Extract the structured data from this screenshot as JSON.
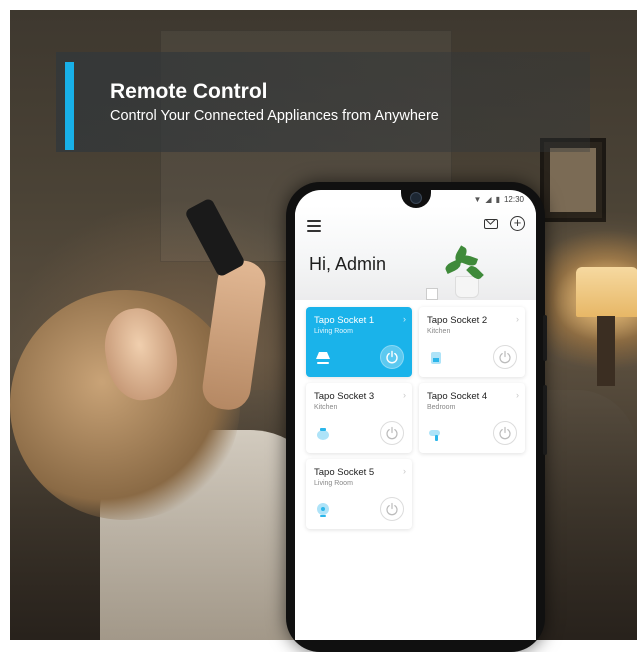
{
  "banner": {
    "title": "Remote Control",
    "subtitle": "Control Your Connected Appliances from Anywhere"
  },
  "status_bar": {
    "time": "12:30",
    "icons": [
      "wifi-icon",
      "signal-icon",
      "battery-icon"
    ]
  },
  "app": {
    "greeting": "Hi, Admin",
    "header_icons": [
      "menu-icon",
      "mail-icon",
      "add-icon"
    ],
    "accent_color": "#1ab3ea",
    "devices": [
      {
        "name": "Tapo Socket 1",
        "room": "Living Room",
        "icon": "lamp-icon",
        "on": true
      },
      {
        "name": "Tapo Socket 2",
        "room": "Kitchen",
        "icon": "coffee-maker-icon",
        "on": false
      },
      {
        "name": "Tapo Socket 3",
        "room": "Kitchen",
        "icon": "kettle-icon",
        "on": false
      },
      {
        "name": "Tapo Socket 4",
        "room": "Bedroom",
        "icon": "hair-dryer-icon",
        "on": false
      },
      {
        "name": "Tapo Socket 5",
        "room": "Living Room",
        "icon": "fan-icon",
        "on": false
      }
    ]
  }
}
